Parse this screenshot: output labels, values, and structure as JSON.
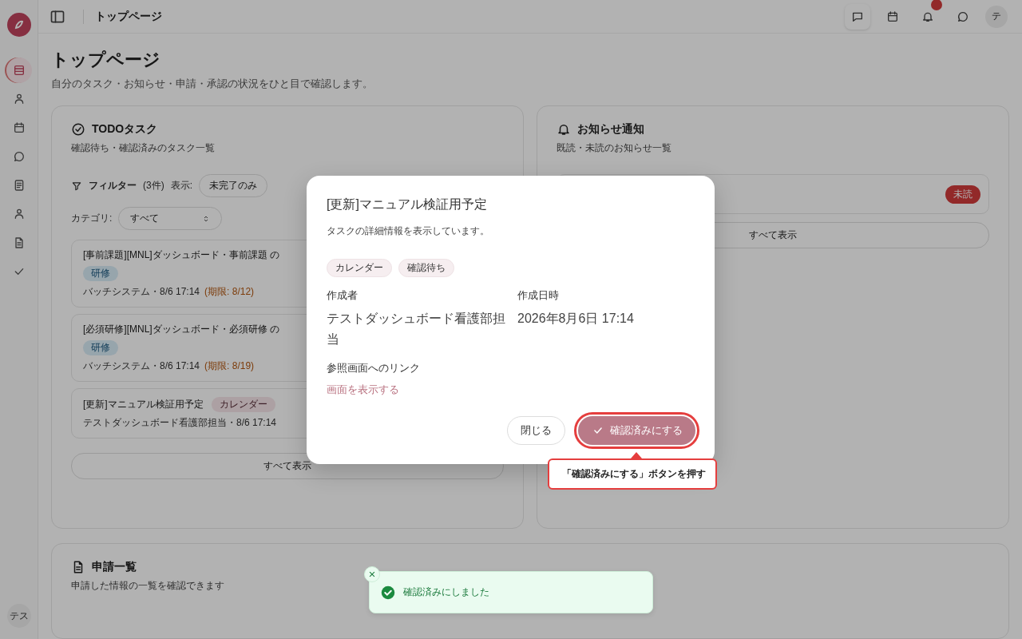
{
  "sidebar": {
    "items": [
      {
        "selected": true
      },
      {
        "selected": false
      },
      {
        "selected": false
      },
      {
        "selected": false
      },
      {
        "selected": false
      },
      {
        "selected": false
      },
      {
        "selected": false
      },
      {
        "selected": false
      }
    ],
    "user": "テス"
  },
  "header": {
    "title": "トップページ",
    "notification_badge": true,
    "avatar": "テ"
  },
  "page": {
    "title": "トップページ",
    "subtitle": "自分のタスク・お知らせ・申請・承認の状況をひと目で確認します。"
  },
  "todo_card": {
    "title": "TODOタスク",
    "subtitle": "確認待ち・確認済みのタスク一覧",
    "filter": {
      "label": "フィルター",
      "count": "(3件)",
      "view_label": "表示:",
      "view_option": "未完了のみ"
    },
    "category": {
      "label": "カテゴリ:",
      "value": "すべて"
    },
    "tasks": [
      {
        "title": "[事前課題][MNL]ダッシュボード・事前課題 の",
        "tag": {
          "label": "研修",
          "kind": "training"
        },
        "meta": "バッチシステム・8/6 17:14",
        "deadline": "(期限: 8/12)"
      },
      {
        "title": "[必須研修][MNL]ダッシュボード・必須研修 の",
        "tag": {
          "label": "研修",
          "kind": "training"
        },
        "meta": "バッチシステム・8/6 17:14",
        "deadline": "(期限: 8/19)"
      },
      {
        "title": "[更新]マニュアル検証用予定",
        "tag": {
          "label": "カレンダー",
          "kind": "calendar"
        },
        "meta": "テストダッシュボード看護部担当・8/6 17:14"
      }
    ],
    "show_all": "すべて表示"
  },
  "notice_card": {
    "title": "お知らせ通知",
    "subtitle": "既読・未読のお知らせ一覧",
    "items": [
      {
        "status": "未読"
      }
    ],
    "show_all": "すべて表示"
  },
  "request_card": {
    "title": "申請一覧",
    "subtitle": "申請した情報の一覧を確認できます"
  },
  "dialog": {
    "title": "[更新]マニュアル検証用予定",
    "description": "タスクの詳細情報を表示しています。",
    "tags": [
      "カレンダー",
      "確認待ち"
    ],
    "fields": [
      {
        "label": "作成者",
        "value": "テストダッシュボード看護部担当"
      },
      {
        "label": "作成日時",
        "value": "2026年8月6日 17:14"
      }
    ],
    "link_label": "参照画面へのリンク",
    "link": "画面を表示する",
    "buttons": [
      {
        "label": "閉じる",
        "kind": "secondary",
        "highlighted": false
      },
      {
        "label": "確認済みにする",
        "kind": "primary",
        "highlighted": true
      }
    ]
  },
  "callout": {
    "text": "「確認済みにする」ボタンを押す"
  },
  "toast": {
    "message": "確認済みにしました"
  }
}
